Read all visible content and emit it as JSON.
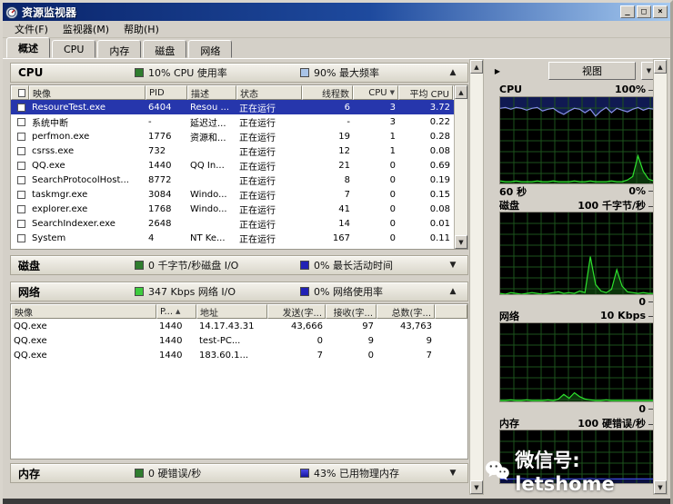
{
  "window": {
    "title": "资源监视器",
    "minimize": "_",
    "maximize": "□",
    "close": "×"
  },
  "menu": [
    "文件(F)",
    "监视器(M)",
    "帮助(H)"
  ],
  "tabs": [
    {
      "label": "概述",
      "active": true
    },
    {
      "label": "CPU",
      "active": false
    },
    {
      "label": "内存",
      "active": false
    },
    {
      "label": "磁盘",
      "active": false
    },
    {
      "label": "网络",
      "active": false
    }
  ],
  "left": {
    "cpu_section": {
      "title": "CPU",
      "legend_green": "10% CPU 使用率",
      "green_color": "#2f7d2f",
      "legend_blue": "90% 最大频率",
      "blue_color": "#a9c4e8",
      "collapse_arrow": "▲"
    },
    "cpu_table": {
      "headers": [
        {
          "label": "映像",
          "sort": ""
        },
        {
          "label": "PID",
          "sort": ""
        },
        {
          "label": "描述",
          "sort": ""
        },
        {
          "label": "状态",
          "sort": ""
        },
        {
          "label": "线程数",
          "sort": ""
        },
        {
          "label": "CPU",
          "sort": "▼"
        },
        {
          "label": "平均 CPU",
          "sort": ""
        }
      ],
      "selected_index": 0,
      "rows": [
        [
          "ResoureTest.exe",
          "6404",
          "Resou ...",
          "正在运行",
          "6",
          "3",
          "3.72"
        ],
        [
          "系统中断",
          "-",
          "延迟过...",
          "正在运行",
          "-",
          "3",
          "0.22"
        ],
        [
          "perfmon.exe",
          "1776",
          "资源和...",
          "正在运行",
          "19",
          "1",
          "0.28"
        ],
        [
          "csrss.exe",
          "732",
          "",
          "正在运行",
          "12",
          "1",
          "0.08"
        ],
        [
          "QQ.exe",
          "1440",
          "QQ In...",
          "正在运行",
          "21",
          "0",
          "0.69"
        ],
        [
          "SearchProtocolHost...",
          "8772",
          "",
          "正在运行",
          "8",
          "0",
          "0.19"
        ],
        [
          "taskmgr.exe",
          "3084",
          "Windo...",
          "正在运行",
          "7",
          "0",
          "0.15"
        ],
        [
          "explorer.exe",
          "1768",
          "Windo...",
          "正在运行",
          "41",
          "0",
          "0.08"
        ],
        [
          "SearchIndexer.exe",
          "2648",
          "",
          "正在运行",
          "14",
          "0",
          "0.01"
        ],
        [
          "System",
          "4",
          "NT Ke...",
          "正在运行",
          "167",
          "0",
          "0.11"
        ]
      ]
    },
    "disk_section": {
      "title": "磁盘",
      "legend_green": "0 千字节/秒磁盘 I/O",
      "green_color": "#2f7d2f",
      "legend_blue": "0% 最长活动时间",
      "blue_color": "#2121b5",
      "collapse_arrow": "▼"
    },
    "network_section": {
      "title": "网络",
      "legend_green": "347 Kbps 网络 I/O",
      "green_color": "#3ecc3e",
      "legend_blue": "0% 网络使用率",
      "blue_color": "#2121b5",
      "collapse_arrow": "▲"
    },
    "network_table": {
      "headers": [
        {
          "label": "映像",
          "sort": ""
        },
        {
          "label": "P...",
          "sort": "▲"
        },
        {
          "label": "地址",
          "sort": ""
        },
        {
          "label": "发送(字...",
          "sort": ""
        },
        {
          "label": "接收(字...",
          "sort": ""
        },
        {
          "label": "总数(字...",
          "sort": ""
        }
      ],
      "rows": [
        [
          "QQ.exe",
          "1440",
          "14.17.43.31",
          "43,666",
          "97",
          "43,763"
        ],
        [
          "QQ.exe",
          "1440",
          "test-PC...",
          "0",
          "9",
          "9"
        ],
        [
          "QQ.exe",
          "1440",
          "183.60.1...",
          "7",
          "0",
          "7"
        ]
      ]
    },
    "memory_section": {
      "title": "内存",
      "legend_green": "0 硬错误/秒",
      "green_color": "#2f7d2f",
      "legend_blue": "43% 已用物理内存",
      "blue_color": "#2a2ad8",
      "collapse_arrow": "▼"
    }
  },
  "right": {
    "expand_arrow": "▶",
    "views_button": "视图",
    "views_dropdown_arrow": "▼",
    "graphs": [
      {
        "id": "cpu",
        "title": "CPU",
        "scale_label": "100%",
        "bottom_left": "60 秒",
        "bottom_right": "0%",
        "series": [
          {
            "color": "#8890e8",
            "fill": "#101a52",
            "fill_mode": "above",
            "values": [
              87,
              88,
              86,
              88,
              87,
              85,
              87,
              88,
              84,
              86,
              87,
              83,
              80,
              84,
              87,
              86,
              82,
              86,
              78,
              84,
              88,
              82,
              87,
              85,
              83,
              86,
              88,
              85,
              87,
              86
            ]
          },
          {
            "color": "#2ee22e",
            "fill": "#0a330a",
            "fill_mode": "below",
            "values": [
              3,
              2,
              2,
              3,
              2,
              2,
              2,
              3,
              2,
              2,
              3,
              2,
              2,
              2,
              3,
              2,
              2,
              3,
              2,
              2,
              2,
              3,
              2,
              2,
              4,
              8,
              32,
              14,
              5,
              3
            ]
          }
        ]
      },
      {
        "id": "disk",
        "title": "磁盘",
        "scale_label": "100 千字节/秒",
        "bottom_left": "",
        "bottom_right": "0",
        "series": [
          {
            "color": "#2ee22e",
            "fill": "#0a330a",
            "fill_mode": "below",
            "values": [
              1,
              0,
              2,
              1,
              0,
              1,
              2,
              1,
              0,
              1,
              2,
              3,
              1,
              2,
              1,
              4,
              2,
              46,
              12,
              4,
              2,
              6,
              30,
              10,
              3,
              2,
              1,
              2,
              1,
              1
            ]
          }
        ]
      },
      {
        "id": "network",
        "title": "网络",
        "scale_label": "10 Kbps",
        "bottom_left": "",
        "bottom_right": "0",
        "series": [
          {
            "color": "#2ee22e",
            "fill": "#0a330a",
            "fill_mode": "below",
            "values": [
              1,
              1,
              2,
              1,
              1,
              2,
              1,
              1,
              1,
              2,
              1,
              3,
              9,
              4,
              11,
              6,
              3,
              2,
              1,
              1,
              2,
              1,
              1,
              1,
              1,
              1,
              1,
              1,
              1,
              1
            ]
          }
        ]
      },
      {
        "id": "memory",
        "title": "内存",
        "scale_label": "100 硬错误/秒",
        "bottom_left": "",
        "bottom_right": "",
        "series": [
          {
            "color": "#3a48d8",
            "fill": "#0a1040",
            "fill_mode": "below",
            "values": [
              8,
              8,
              8,
              8,
              9,
              8,
              8,
              8,
              8,
              8,
              9,
              8,
              8,
              8,
              8,
              8,
              8,
              9,
              8,
              8,
              8,
              8,
              8,
              8,
              8,
              8,
              8,
              8,
              8,
              8
            ]
          }
        ]
      }
    ]
  },
  "watermark": "微信号: letshome"
}
